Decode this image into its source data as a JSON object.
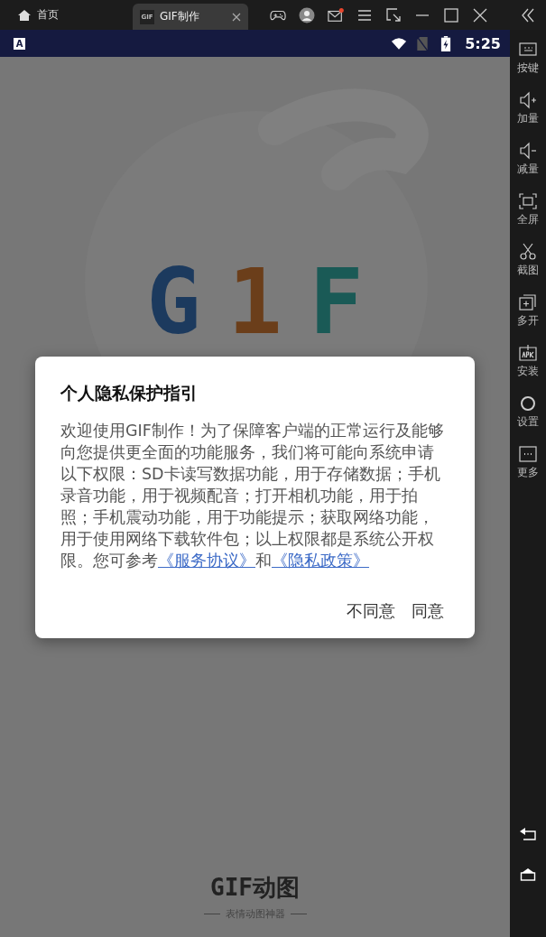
{
  "titlebar": {
    "home_tab": "首页",
    "tabs": [
      {
        "icon_text": "GIF",
        "label": "GIF制作",
        "selected": true
      }
    ],
    "mail_unread": true
  },
  "status_bar": {
    "input_indicator": "A",
    "time": "5:25"
  },
  "splash": {
    "logo_letters": [
      {
        "text": "G",
        "color": "#1c3a5e"
      },
      {
        "text": "1",
        "color": "#6b3e1a"
      },
      {
        "text": "F",
        "color": "#1a5a56"
      }
    ],
    "app_name": "GIF动图",
    "tagline": "表情动图神器"
  },
  "dialog": {
    "title": "个人隐私保护指引",
    "message": [
      {
        "kind": "text",
        "text": "欢迎使用GIF制作！为了保障客户端的正常运行及能够向您提供更全面的功能服务，我们将可能向系统申请以下权限：SD卡读写数据功能，用于存储数据；手机录音功能，用于视频配音；打开相机功能，用于拍照；手机震动功能，用于功能提示；获取网络功能，用于使用网络下载软件包；以上权限都是系统公开权限。您可参考"
      },
      {
        "kind": "link",
        "text": "《服务协议》"
      },
      {
        "kind": "text",
        "text": "和"
      },
      {
        "kind": "link",
        "text": "《隐私政策》"
      }
    ],
    "buttons": [
      "不同意",
      "同意"
    ]
  },
  "sidebar": {
    "items": [
      {
        "kind": "keyboard",
        "label": "按键"
      },
      {
        "kind": "volume-up",
        "label": "加量"
      },
      {
        "kind": "volume-down",
        "label": "减量"
      },
      {
        "kind": "fullscreen",
        "label": "全屏"
      },
      {
        "kind": "scissors",
        "label": "截图"
      },
      {
        "kind": "multi",
        "label": "多开"
      },
      {
        "kind": "apk",
        "label": "安装"
      },
      {
        "kind": "settings",
        "label": "设置"
      },
      {
        "kind": "more",
        "label": "更多"
      }
    ]
  }
}
